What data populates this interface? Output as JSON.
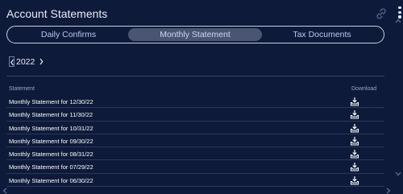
{
  "header": {
    "title": "Account Statements"
  },
  "tabs": [
    {
      "label": "Daily Confirms",
      "active": false
    },
    {
      "label": "Monthly Statement",
      "active": true
    },
    {
      "label": "Tax Documents",
      "active": false
    }
  ],
  "year_nav": {
    "year": "2022"
  },
  "table": {
    "columns": {
      "statement": "Statement",
      "download": "Download"
    },
    "rows": [
      {
        "label": "Monthly Statement for 12/30/22"
      },
      {
        "label": "Monthly Statement for 11/30/22"
      },
      {
        "label": "Monthly Statement for 10/31/22"
      },
      {
        "label": "Monthly Statement for 09/30/22"
      },
      {
        "label": "Monthly Statement for 08/31/22"
      },
      {
        "label": "Monthly Statement for 07/29/22"
      },
      {
        "label": "Monthly Statement for 06/30/22"
      }
    ]
  },
  "colors": {
    "background": "#0d1a3a",
    "active_tab": "#4a5573",
    "tab_text": "#b8c7f0",
    "border": "#c9cfdc"
  },
  "icons": {
    "link": "link-icon",
    "menu": "kebab-menu-icon",
    "download": "download-tray-icon",
    "prev": "chevron-left-icon",
    "next": "chevron-right-icon"
  }
}
